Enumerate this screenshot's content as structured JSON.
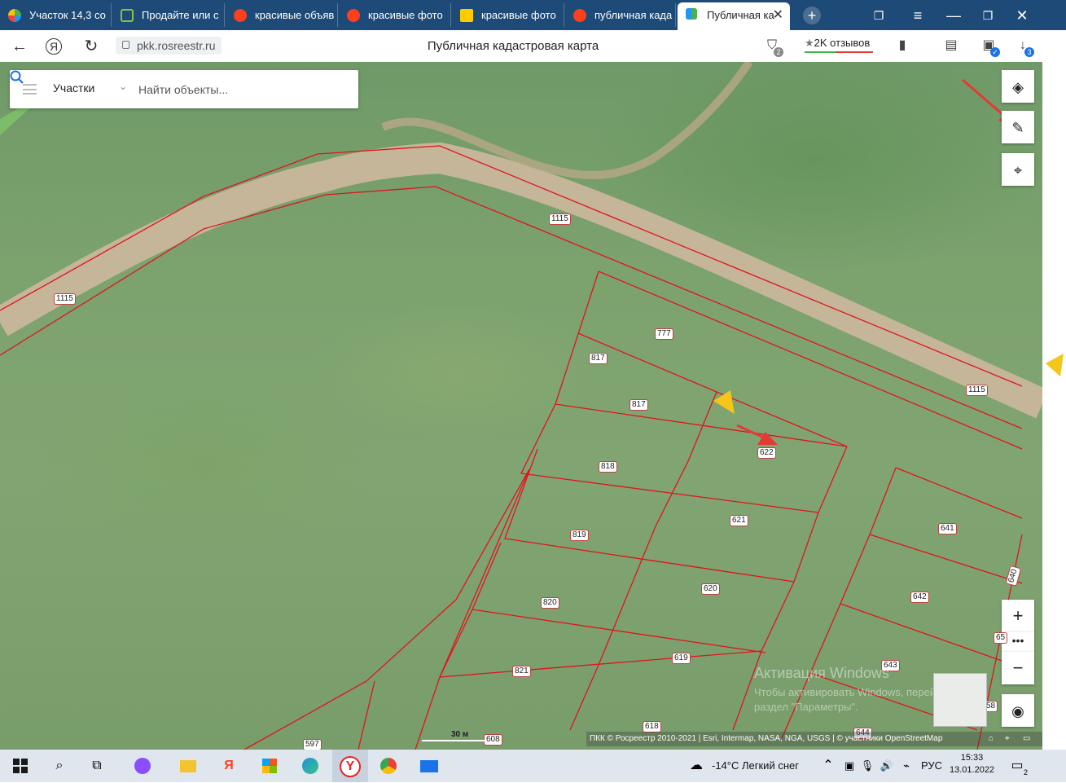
{
  "tabs": [
    {
      "title": "Участок 14,3 со",
      "icon": "app-grid-icon"
    },
    {
      "title": "Продайте или с",
      "icon": "avito-icon"
    },
    {
      "title": "красивые объяв",
      "icon": "yandex-icon"
    },
    {
      "title": "красивые фото",
      "icon": "yandex-icon"
    },
    {
      "title": "красивые фото",
      "icon": "yandex-images-icon"
    },
    {
      "title": "публичная када",
      "icon": "yandex-icon"
    },
    {
      "title": "Публичная ка",
      "icon": "pkk-icon",
      "active": true
    }
  ],
  "addressbar": {
    "url": "pkk.rosreestr.ru",
    "page_title": "Публичная кадастровая карта",
    "reviews": "2K отзывов",
    "shield_badge": "2",
    "download_badge": "3"
  },
  "search": {
    "category": "Участки",
    "placeholder": "Найти объекты..."
  },
  "map": {
    "labels": [
      "1115",
      "1115",
      "1115",
      "777",
      "817",
      "817",
      "622",
      "818",
      "621",
      "819",
      "620",
      "820",
      "619",
      "821",
      "618",
      "597",
      "608",
      "641",
      "642",
      "643",
      "644",
      "640",
      "65",
      "58"
    ],
    "scale": "30 м",
    "attribution": "ПКК © Росреестр 2010-2021 | Esri, Intermap, NASA, NGA, USGS | © участники OpenStreetMap",
    "watermark_title": "Активация Windows",
    "watermark_line1": "Чтобы активировать Windows, перейдите в",
    "watermark_line2": "раздел \"Параметры\"."
  },
  "taskbar": {
    "weather": "-14°C  Легкий снег",
    "lang": "РУС",
    "time": "15:33",
    "date": "13.01.2022",
    "notif_count": "2"
  },
  "colors": {
    "parcel_line": "#e0141e",
    "label_border": "#b44444",
    "tab_bg": "#1e4a78"
  }
}
